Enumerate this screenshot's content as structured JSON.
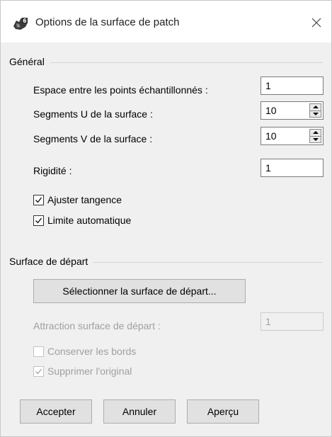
{
  "window": {
    "title": "Options de la surface de patch",
    "app_icon": "rhino-icon",
    "close_icon": "close-icon"
  },
  "general": {
    "label": "Général",
    "spacing": {
      "label": "Espace entre les points échantillonnés :",
      "value": "1"
    },
    "u_segments": {
      "label": "Segments U de la surface :",
      "value": "10"
    },
    "v_segments": {
      "label": "Segments V de la surface :",
      "value": "10"
    },
    "stiffness": {
      "label": "Rigidité :",
      "value": "1"
    },
    "adjust_tangency": {
      "label": "Ajuster tangence",
      "checked": true
    },
    "auto_trim": {
      "label": "Limite automatique",
      "checked": true
    }
  },
  "starting_surface": {
    "label": "Surface de départ",
    "select_button": "Sélectionner la surface de départ...",
    "pull": {
      "label": "Attraction surface de départ :",
      "value": "1",
      "enabled": false
    },
    "preserve_edges": {
      "label": "Conserver les bords",
      "checked": false,
      "enabled": false
    },
    "delete_input": {
      "label": "Supprimer l'original",
      "checked": true,
      "enabled": false
    }
  },
  "buttons": {
    "ok": "Accepter",
    "cancel": "Annuler",
    "preview": "Aperçu"
  }
}
